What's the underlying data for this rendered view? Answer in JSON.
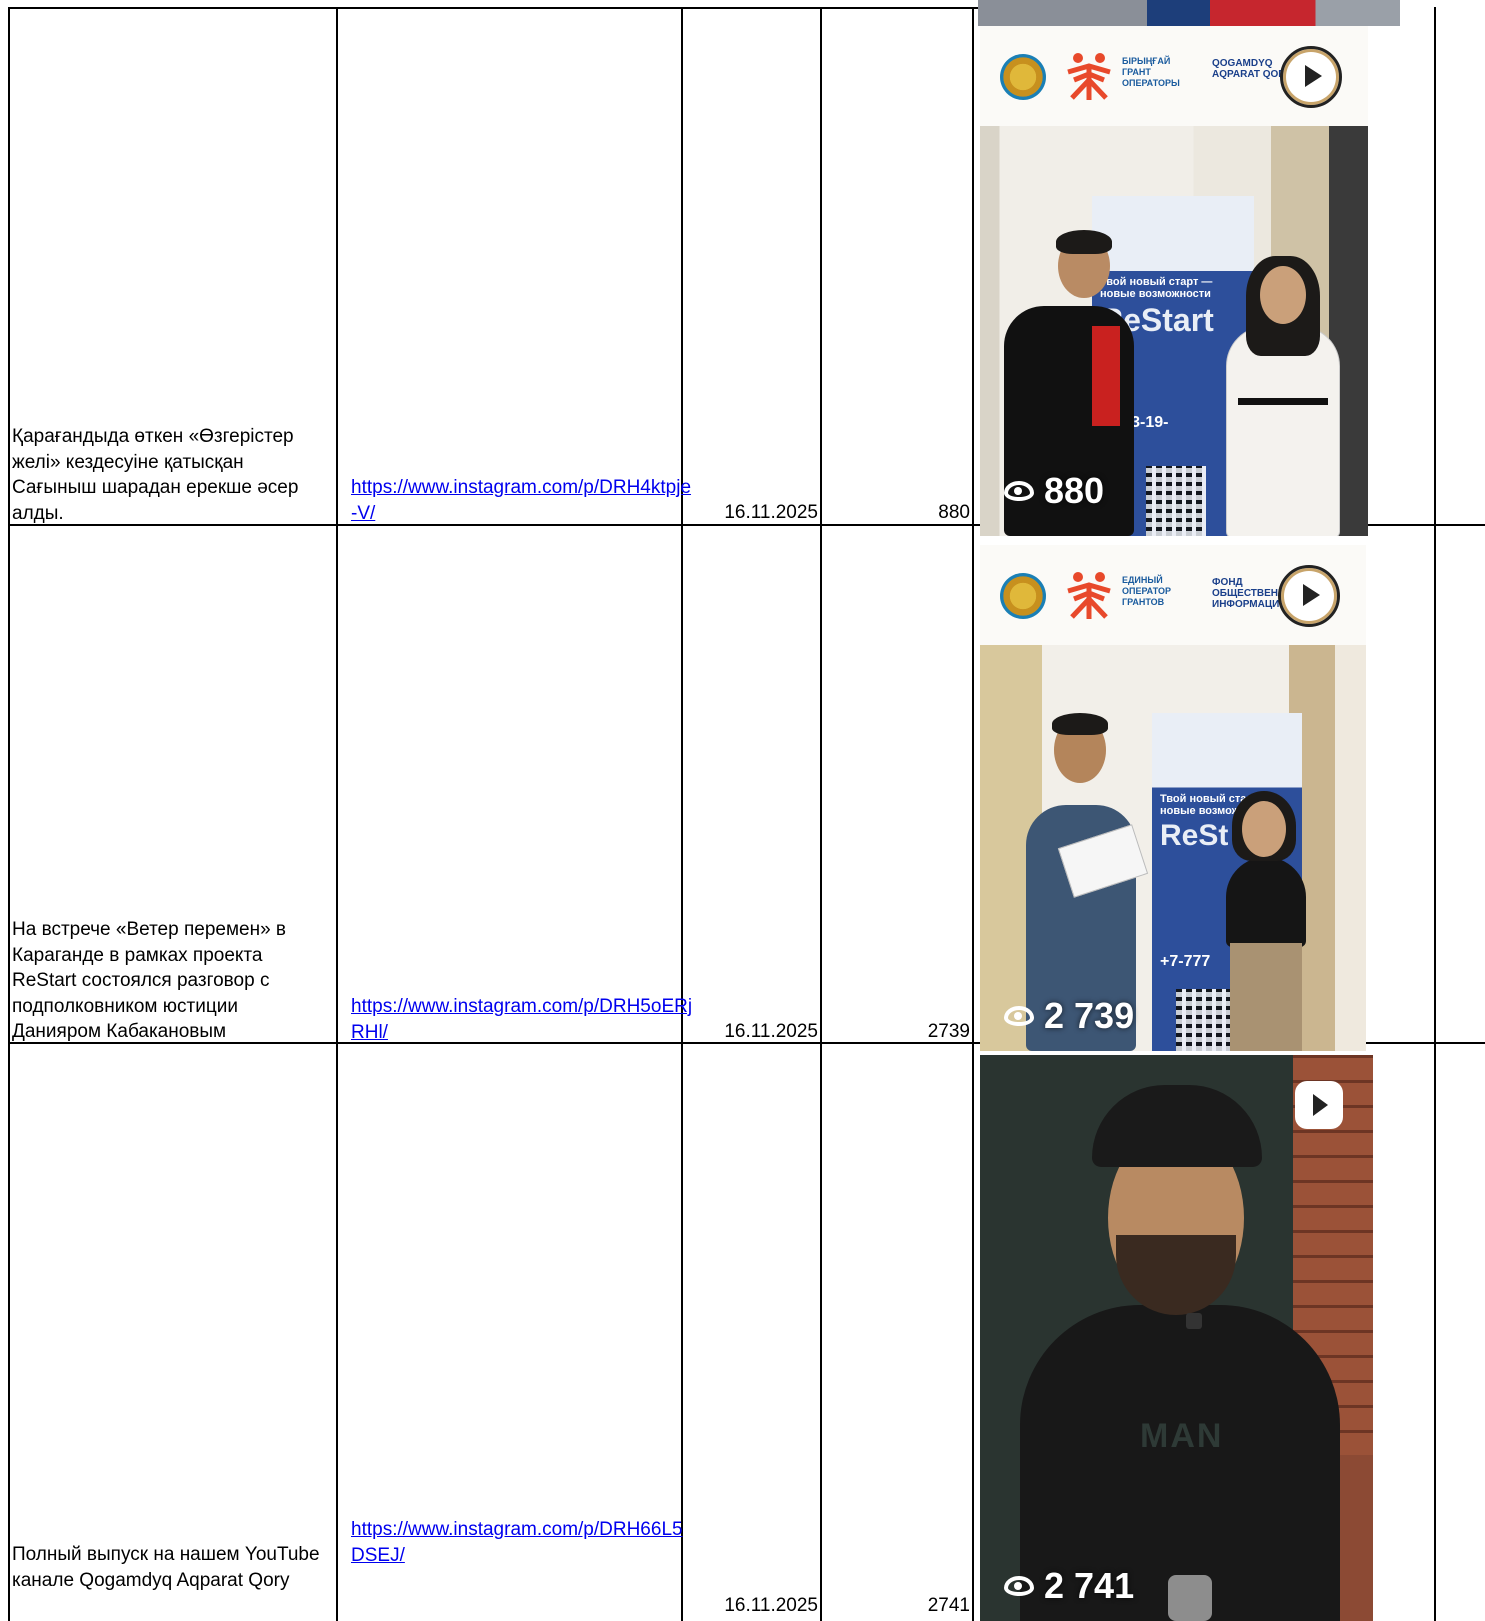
{
  "rows": [
    {
      "description": "Қарағандыда өткен «Өзгерістер желі» кездесуіне қатысқан Сағыныш шарадан ерекше әсер алды.",
      "link": "https://www.instagram.com/p/DRH4ktpje-V/",
      "date": "16.11.2025",
      "views": "880",
      "screenshot": {
        "views_overlay": "880",
        "grant_logo_text": "БІРЫҢҒАЙ ГРАНТ ОПЕРАТОРЫ",
        "fund_logo_text": "QOGAMDYQ AQPARAT QORY",
        "banner_title": "ReStart",
        "banner_subtitle": "Твой новый старт — новые возможности",
        "banner_phone": "7 513-19-"
      }
    },
    {
      "description": "На встрече «Ветер перемен» в Караганде в рамках проекта ReStart состоялся разговор с подполковником юстиции Данияром Кабакановым",
      "link": "https://www.instagram.com/p/DRH5oERjRHl/",
      "date": "16.11.2025",
      "views": "2739",
      "screenshot": {
        "views_overlay": "2 739",
        "grant_logo_text": "ЕДИНЫЙ ОПЕРАТОР ГРАНТОВ",
        "fund_logo_text": "ФОНД ОБЩЕСТВЕННОЙ ИНФОРМАЦИИ",
        "banner_title": "ReSt",
        "banner_subtitle": "Твой новый старт — новые возможно",
        "banner_phone": "+7-777"
      }
    },
    {
      "description": "Полный выпуск на нашем YouTube канале Qogamdyq Aqparat Qory",
      "link": "https://www.instagram.com/p/DRH66L5DSEJ/",
      "date": "16.11.2025",
      "views": "2741",
      "screenshot": {
        "views_overlay": "2 741",
        "shirt_text": "MAN"
      }
    }
  ],
  "colors": {
    "link": "#0000ee",
    "grid": "#000000",
    "banner_blue": "#2d4f9b",
    "logo_orange": "#e8492b"
  }
}
